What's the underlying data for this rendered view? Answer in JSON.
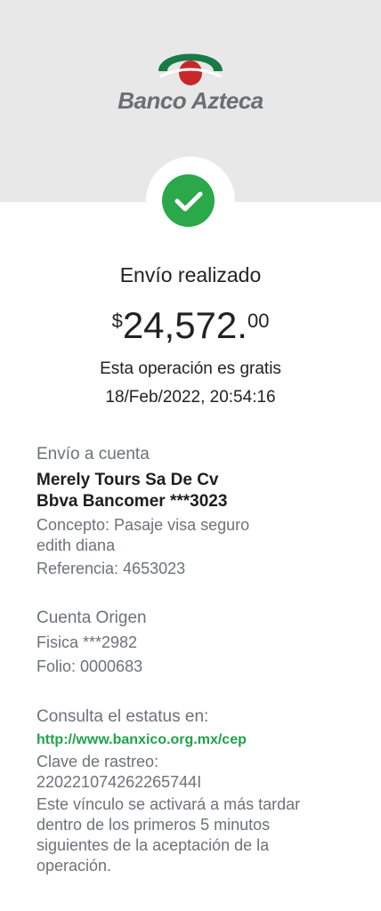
{
  "header": {
    "brand_name": "Banco Azteca",
    "logo_icon": "banco-azteca-logo",
    "bg_color": "#e8e8e8"
  },
  "status": {
    "icon": "check-icon",
    "color": "#2aa84a",
    "title": "Envío realizado"
  },
  "amount": {
    "currency": "$",
    "integer": "24,572.",
    "decimals": "00"
  },
  "fee_note": "Esta operación es gratis",
  "datetime": "18/Feb/2022, 20:54:16",
  "destination": {
    "label": "Envío a cuenta",
    "name": "Merely Tours Sa De Cv",
    "bank_account": "Bbva Bancomer ***3023",
    "concept_line1": "Concepto: Pasaje visa seguro",
    "concept_line2": "edith diana",
    "reference": "Referencia: 4653023"
  },
  "origin": {
    "label": "Cuenta Origen",
    "account": "Fisica ***2982",
    "folio": "Folio: 0000683"
  },
  "tracking": {
    "label": "Consulta el estatus en:",
    "url": "http://www.banxico.org.mx/cep",
    "key_label": "Clave de rastreo:",
    "key_value": "220221074262265744I",
    "note_lines": [
      "Este vínculo se activará a más tardar",
      "dentro de los primeros 5 minutos",
      "siguientes de la aceptación de la",
      "operación."
    ],
    "link_color": "#1fa34a"
  }
}
